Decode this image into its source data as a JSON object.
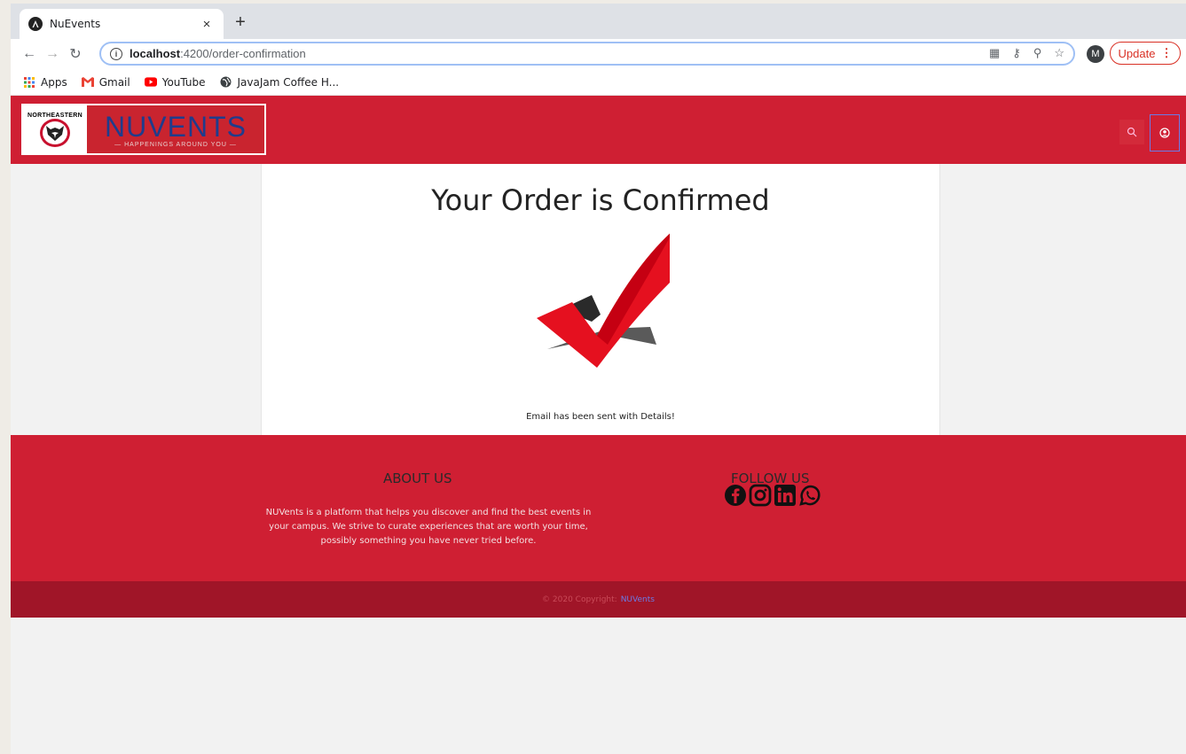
{
  "browser": {
    "tab_title": "NuEvents",
    "tab_close": "×",
    "new_tab": "+",
    "url_host": "localhost",
    "url_path": ":4200/order-confirmation",
    "avatar_letter": "M",
    "update_label": "Update",
    "bookmarks": [
      {
        "label": "Apps",
        "icon": "apps-grid-icon"
      },
      {
        "label": "Gmail",
        "icon": "gmail-icon"
      },
      {
        "label": "YouTube",
        "icon": "youtube-icon"
      },
      {
        "label": "JavaJam Coffee H...",
        "icon": "globe-icon"
      }
    ]
  },
  "header": {
    "logo_university": "NORTHEASTERN",
    "logo_main": "NUVENTS",
    "logo_tagline": "— HAPPENINGS AROUND YOU —"
  },
  "main": {
    "title": "Your Order is Confirmed",
    "email_message": "Email has been sent with Details!"
  },
  "footer": {
    "about_title": "ABOUT US",
    "about_text": "NUVents is a platform that helps you discover and find the best events in your campus. We strive to curate experiences that are worth your time, possibly something you have never tried before.",
    "follow_title": "FOLLOW US",
    "social": [
      "facebook-icon",
      "instagram-icon",
      "linkedin-icon",
      "whatsapp-icon"
    ],
    "copyright_text": "© 2020 Copyright:",
    "copyright_link": "NUVents"
  },
  "colors": {
    "brand_red": "#cf1f33",
    "dark_red": "#a01528",
    "logo_blue": "#1f3c8c"
  }
}
